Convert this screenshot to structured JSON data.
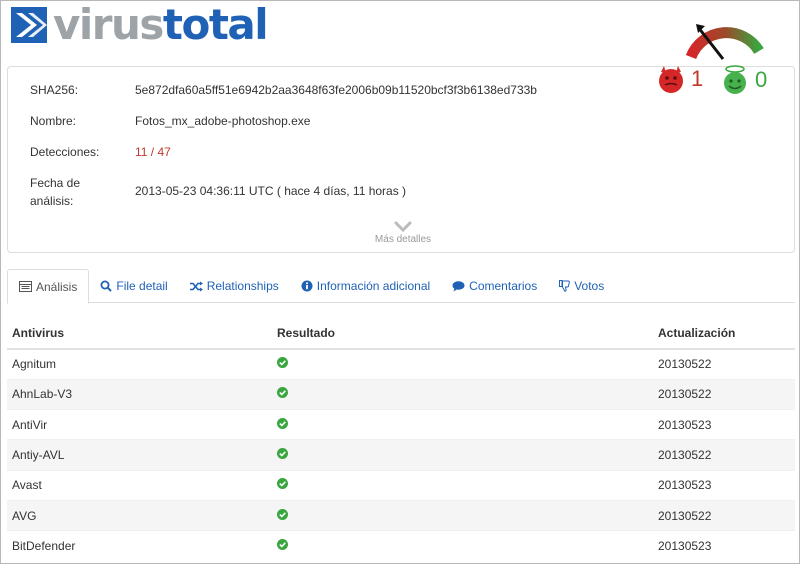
{
  "logo": {
    "part1": "virus",
    "part2": "total"
  },
  "summary": {
    "sha_label": "SHA256:",
    "sha_value": "5e872dfa60a5ff51e6942b2aa3648f63fe2006b09b11520bcf3f3b6138ed733b",
    "name_label": "Nombre:",
    "name_value": "Fotos_mx_adobe-photoshop.exe",
    "det_label": "Detecciones:",
    "det_value": "11 / 47",
    "date_label_1": "Fecha de",
    "date_label_2": "análisis:",
    "date_value": "2013-05-23 04:36:11 UTC ( hace 4 días, 11 horas )",
    "more_label": "Más detalles"
  },
  "votes": {
    "bad": "1",
    "good": "0",
    "bad_color": "#c0392b",
    "good_color": "#3aa640"
  },
  "tabs": [
    {
      "label": "Análisis",
      "icon": "table-icon"
    },
    {
      "label": "File detail",
      "icon": "search-icon"
    },
    {
      "label": "Relationships",
      "icon": "shuffle-icon"
    },
    {
      "label": "Información adicional",
      "icon": "info-icon"
    },
    {
      "label": "Comentarios",
      "icon": "comment-icon"
    },
    {
      "label": "Votos",
      "icon": "thumbs-down-icon"
    }
  ],
  "table": {
    "headers": [
      "Antivirus",
      "Resultado",
      "Actualización"
    ],
    "rows": [
      {
        "name": "Agnitum",
        "update": "20130522"
      },
      {
        "name": "AhnLab-V3",
        "update": "20130522"
      },
      {
        "name": "AntiVir",
        "update": "20130523"
      },
      {
        "name": "Antiy-AVL",
        "update": "20130522"
      },
      {
        "name": "Avast",
        "update": "20130523"
      },
      {
        "name": "AVG",
        "update": "20130522"
      },
      {
        "name": "BitDefender",
        "update": "20130523"
      }
    ]
  },
  "colors": {
    "brand": "#1f62b5",
    "link": "#1f62b5",
    "clean": "#3aa640",
    "alert": "#c0392b"
  }
}
